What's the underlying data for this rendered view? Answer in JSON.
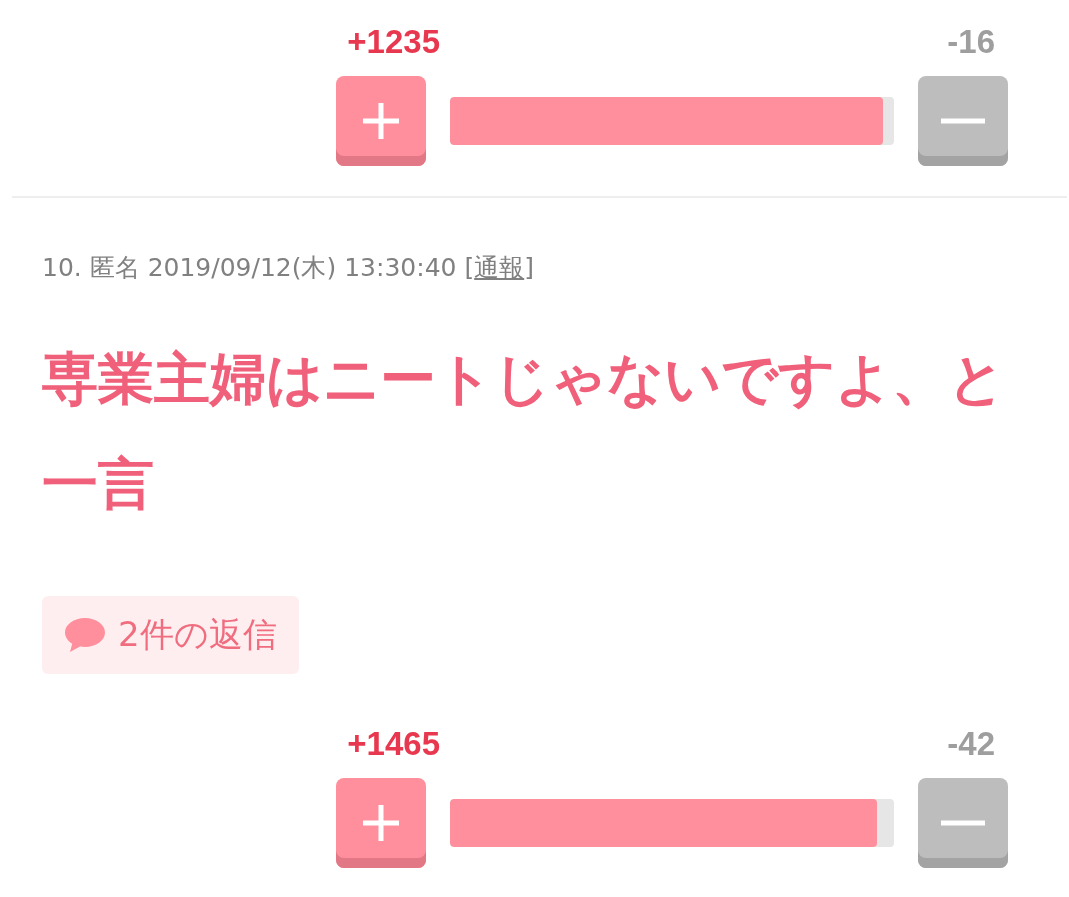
{
  "votes_top": {
    "plus_count": "+1235",
    "minus_count": "-16",
    "level": 0.975
  },
  "comment": {
    "meta": "10. 匿名 2019/09/12(木) 13:30:40 [",
    "report_link": "通報",
    "meta_end": "]",
    "body": "専業主婦はニートじゃないですよ、と一言",
    "replies": "2件の返信",
    "votes": {
      "plus_count": "+1465",
      "minus_count": "-42",
      "level": 0.962
    }
  }
}
